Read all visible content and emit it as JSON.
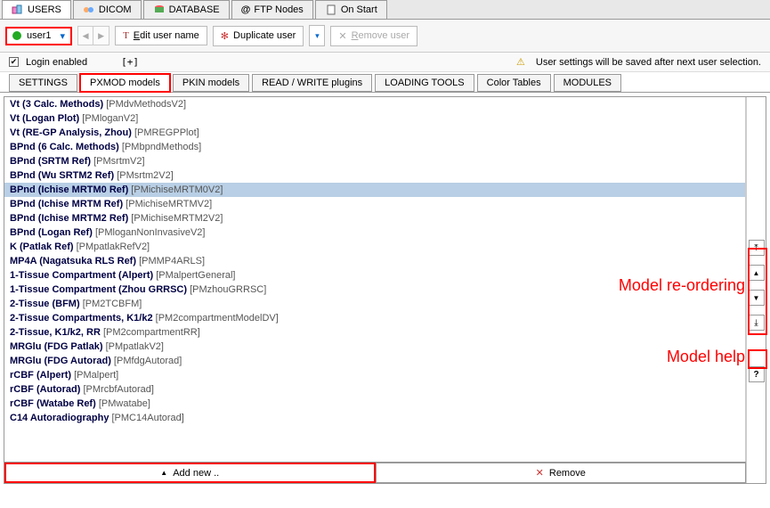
{
  "top_tabs": {
    "users": "USERS",
    "dicom": "DICOM",
    "database": "DATABASE",
    "ftp": "FTP Nodes",
    "onstart": "On Start"
  },
  "toolbar": {
    "user_label": "user1",
    "edit_user_prefix": "E",
    "edit_user_rest": "dit user name",
    "duplicate_user": "Duplicate user",
    "remove_user_prefix": "R",
    "remove_user_rest": "emove user"
  },
  "settings_row": {
    "login_enabled": "Login enabled",
    "plus": "[+]",
    "warning_msg": "User settings will be saved after next user selection."
  },
  "sub_tabs": {
    "settings": "SETTINGS",
    "pxmod": "PXMOD models",
    "pkin": "PKIN models",
    "readwrite": "READ / WRITE plugins",
    "loading": "LOADING TOOLS",
    "color": "Color Tables",
    "modules": "MODULES"
  },
  "models": [
    {
      "name": "Vt (3 Calc. Methods)",
      "code": "[PMdvMethodsV2]"
    },
    {
      "name": "Vt (Logan Plot)",
      "code": "[PMloganV2]"
    },
    {
      "name": "Vt (RE-GP Analysis, Zhou)",
      "code": "[PMREGPPlot]"
    },
    {
      "name": "BPnd (6 Calc. Methods)",
      "code": "[PMbpndMethods]"
    },
    {
      "name": "BPnd (SRTM Ref)",
      "code": "[PMsrtmV2]"
    },
    {
      "name": "BPnd (Wu SRTM2 Ref)",
      "code": "[PMsrtm2V2]"
    },
    {
      "name": "BPnd (Ichise MRTM0 Ref)",
      "code": "[PMichiseMRTM0V2]",
      "selected": true
    },
    {
      "name": "BPnd (Ichise MRTM Ref)",
      "code": "[PMichiseMRTMV2]"
    },
    {
      "name": "BPnd (Ichise MRTM2 Ref)",
      "code": "[PMichiseMRTM2V2]"
    },
    {
      "name": "BPnd (Logan Ref)",
      "code": "[PMloganNonInvasiveV2]"
    },
    {
      "name": "K (Patlak Ref)",
      "code": "[PMpatlakRefV2]"
    },
    {
      "name": "MP4A (Nagatsuka RLS Ref)",
      "code": "[PMMP4ARLS]"
    },
    {
      "name": "1-Tissue Compartment (Alpert)",
      "code": "[PMalpertGeneral]"
    },
    {
      "name": "1-Tissue Compartment (Zhou GRRSC)",
      "code": "[PMzhouGRRSC]"
    },
    {
      "name": "2-Tissue (BFM)",
      "code": "[PM2TCBFM]"
    },
    {
      "name": "2-Tissue Compartments, K1/k2",
      "code": "[PM2compartmentModelDV]"
    },
    {
      "name": "2-Tissue, K1/k2, RR",
      "code": "[PM2compartmentRR]"
    },
    {
      "name": "MRGlu (FDG Patlak)",
      "code": "[PMpatlakV2]"
    },
    {
      "name": "MRGlu (FDG Autorad)",
      "code": "[PMfdgAutorad]"
    },
    {
      "name": "rCBF (Alpert)",
      "code": "[PMalpert]"
    },
    {
      "name": "rCBF (Autorad)",
      "code": "[PMrcbfAutorad]"
    },
    {
      "name": "rCBF (Watabe Ref)",
      "code": "[PMwatabe]"
    },
    {
      "name": "C14 Autoradiography",
      "code": "[PMC14Autorad]"
    }
  ],
  "side": {
    "top": "⤒",
    "up": "▲",
    "down": "▼",
    "bottom": "⤓",
    "help": "?"
  },
  "bottom": {
    "add_new": "Add new ..",
    "remove": "Remove"
  },
  "annotations": {
    "reorder": "Model re-ordering",
    "help": "Model help"
  }
}
